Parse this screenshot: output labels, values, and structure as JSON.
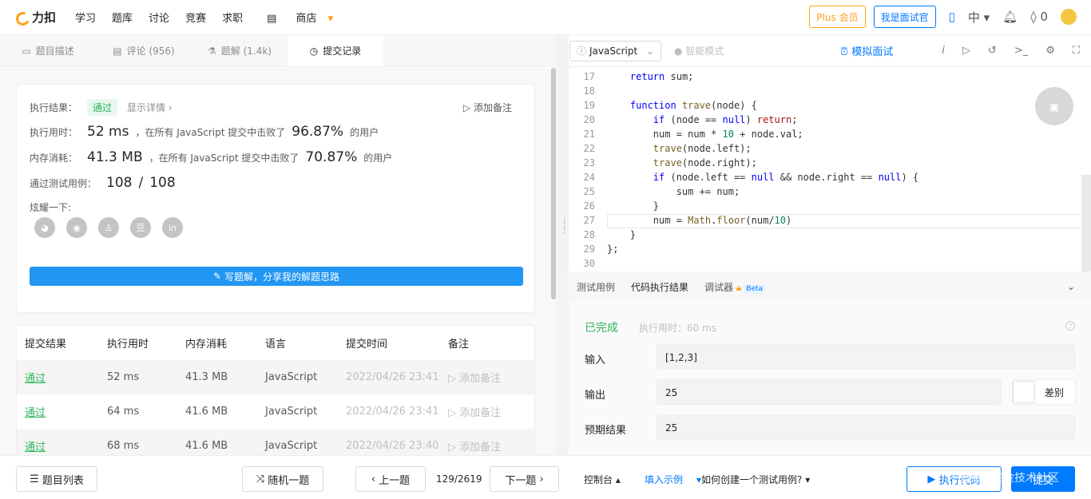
{
  "topbar": {
    "logo_text": "力扣",
    "nav": [
      "学习",
      "题库",
      "讨论",
      "竞赛",
      "求职",
      "商店"
    ],
    "plus_label": "Plus 会员",
    "interviewer_label": "我是面试官",
    "lang_label": "中",
    "points": "0"
  },
  "tabs": [
    {
      "label": "题目描述",
      "icon": "doc-icon"
    },
    {
      "label": "评论 (956)",
      "icon": "comment-icon"
    },
    {
      "label": "题解 (1.4k)",
      "icon": "flask-icon"
    },
    {
      "label": "提交记录",
      "icon": "clock-icon"
    }
  ],
  "result_card": {
    "result_label": "执行结果：",
    "result_value": "通过",
    "detail_link": "显示详情 ›",
    "add_note": "添加备注",
    "time_label": "执行用时：",
    "time_value": "52 ms",
    "time_mid": "，在所有 JavaScript 提交中击败了",
    "time_pct": "96.87%",
    "time_suffix": "的用户",
    "mem_label": "内存消耗：",
    "mem_value": "41.3 MB",
    "mem_mid": "，在所有 JavaScript 提交中击败了",
    "mem_pct": "70.87%",
    "mem_suffix": "的用户",
    "tests_label": "通过测试用例：",
    "tests_passed": "108",
    "tests_sep": "/",
    "tests_total": "108",
    "share_label": "炫耀一下:",
    "share_icons": [
      "wechat-icon",
      "weibo-icon",
      "qq-icon",
      "douban-icon",
      "linkedin-icon"
    ],
    "write_button": "写题解，分享我的解题思路"
  },
  "submissions": {
    "headers": [
      "提交结果",
      "执行用时",
      "内存消耗",
      "语言",
      "提交时间",
      "备注"
    ],
    "rows": [
      {
        "result": "通过",
        "time": "52 ms",
        "mem": "41.3 MB",
        "lang": "JavaScript",
        "date": "2022/04/26 23:41",
        "note": "添加备注"
      },
      {
        "result": "通过",
        "time": "64 ms",
        "mem": "41.6 MB",
        "lang": "JavaScript",
        "date": "2022/04/26 23:41",
        "note": "添加备注"
      },
      {
        "result": "通过",
        "time": "68 ms",
        "mem": "41.6 MB",
        "lang": "JavaScript",
        "date": "2022/04/26 23:40",
        "note": "添加备注"
      }
    ]
  },
  "editor_toolbar": {
    "language": "JavaScript",
    "smart_mode": "智能模式",
    "mock_interview": "模拟面试"
  },
  "code": {
    "lines": [
      {
        "n": "17",
        "text": "    return sum;"
      },
      {
        "n": "18",
        "text": ""
      },
      {
        "n": "19",
        "text": "    function trave(node) {"
      },
      {
        "n": "20",
        "text": "        if (node == null) return;"
      },
      {
        "n": "21",
        "text": "        num = num * 10 + node.val;"
      },
      {
        "n": "22",
        "text": "        trave(node.left);"
      },
      {
        "n": "23",
        "text": "        trave(node.right);"
      },
      {
        "n": "24",
        "text": "        if (node.left == null && node.right == null) {"
      },
      {
        "n": "25",
        "text": "            sum += num;"
      },
      {
        "n": "26",
        "text": "        }"
      },
      {
        "n": "27",
        "text": "        num = Math.floor(num/10)"
      },
      {
        "n": "28",
        "text": "    }"
      },
      {
        "n": "29",
        "text": "};"
      },
      {
        "n": "30",
        "text": ""
      }
    ]
  },
  "result_tabs": {
    "tabs": [
      "测试用例",
      "代码执行结果",
      "调试器"
    ],
    "beta": "Beta"
  },
  "run_result": {
    "status": "已完成",
    "exec_time": "执行用时：60 ms",
    "input_label": "输入",
    "input_value": "[1,2,3]",
    "output_label": "输出",
    "output_value": "25",
    "diff_label": "差别",
    "expected_label": "预期结果",
    "expected_value": "25"
  },
  "bottombar": {
    "problem_list": "题目列表",
    "random": "随机一题",
    "prev": "上一题",
    "page": "129/2619",
    "next": "下一题",
    "console": "控制台",
    "fill_example": "填入示例",
    "howto": "如何创建一个测试用例?",
    "run": "执行代码",
    "submit": "提交",
    "watermark": "@稀土掘金技术社区"
  }
}
